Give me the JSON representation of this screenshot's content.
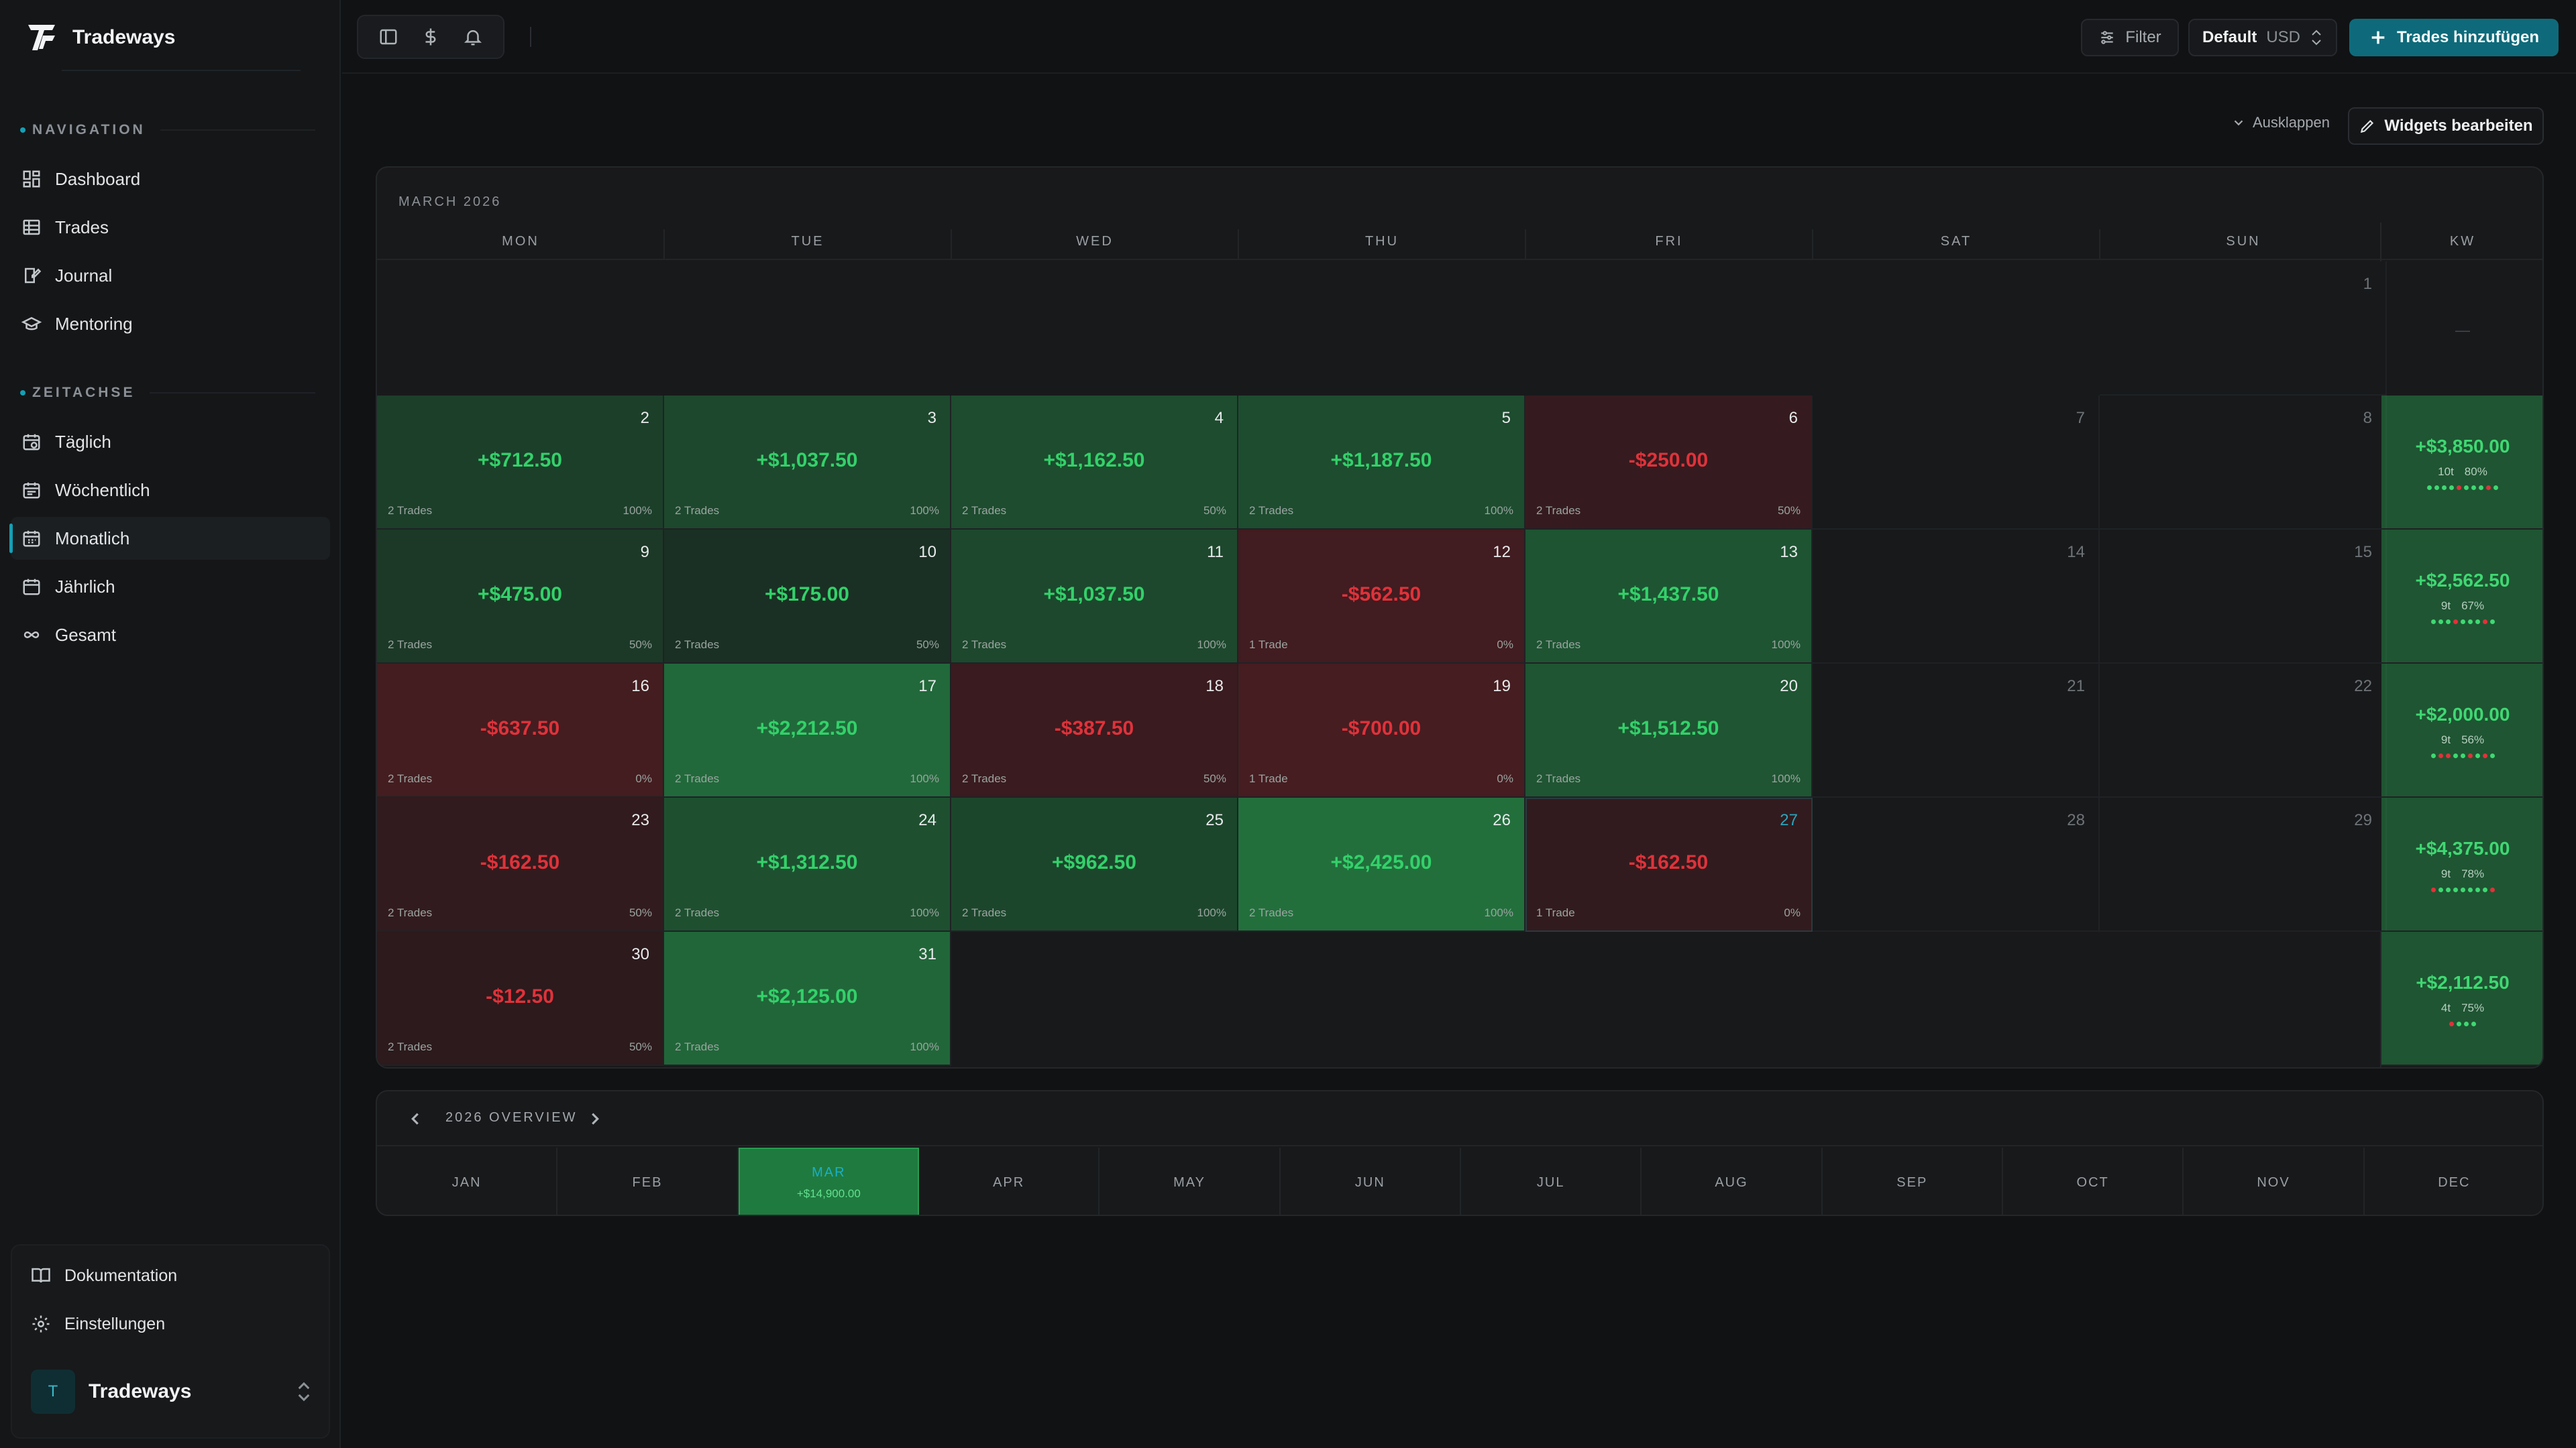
{
  "brand": {
    "name": "Tradeways"
  },
  "sidebar": {
    "section_nav": "NAVIGATION",
    "nav": [
      {
        "label": "Dashboard",
        "icon": "dashboard-icon"
      },
      {
        "label": "Trades",
        "icon": "table-icon"
      },
      {
        "label": "Journal",
        "icon": "journal-icon"
      },
      {
        "label": "Mentoring",
        "icon": "graduation-cap-icon"
      }
    ],
    "section_time": "ZEITACHSE",
    "timeline": [
      {
        "label": "Täglich",
        "icon": "calendar-clock-icon"
      },
      {
        "label": "Wöchentlich",
        "icon": "calendar-week-icon"
      },
      {
        "label": "Monatlich",
        "icon": "calendar-month-icon",
        "active": true
      },
      {
        "label": "Jährlich",
        "icon": "calendar-icon"
      },
      {
        "label": "Gesamt",
        "icon": "infinity-icon"
      }
    ],
    "bottom": [
      {
        "label": "Dokumentation",
        "icon": "book-icon"
      },
      {
        "label": "Einstellungen",
        "icon": "gear-icon"
      }
    ],
    "user": {
      "initial": "T",
      "name": "Tradeways"
    }
  },
  "topbar": {
    "filter_label": "Filter",
    "account_label": "Default",
    "currency_label": "USD",
    "add_label": "Trades hinzufügen"
  },
  "toolbar": {
    "collapse_label": "Ausklappen",
    "widgets_label": "Widgets bearbeiten"
  },
  "colors": {
    "accent": "#0e6a7a",
    "positive": "#33d16a",
    "negative": "#e0323a"
  },
  "calendar": {
    "title": "MARCH 2026",
    "weekdays": [
      "MON",
      "TUE",
      "WED",
      "THU",
      "FRI",
      "SAT",
      "SUN",
      "KW"
    ],
    "empty_kw": "—",
    "days": [
      {
        "n": "1",
        "row": 0,
        "col": 6
      },
      {
        "n": "2",
        "row": 1,
        "col": 0,
        "pnl": "+$712.50",
        "trades": "2 Trades",
        "rate": "100%",
        "value": 712.5
      },
      {
        "n": "3",
        "row": 1,
        "col": 1,
        "pnl": "+$1,037.50",
        "trades": "2 Trades",
        "rate": "100%",
        "value": 1037.5
      },
      {
        "n": "4",
        "row": 1,
        "col": 2,
        "pnl": "+$1,162.50",
        "trades": "2 Trades",
        "rate": "50%",
        "value": 1162.5
      },
      {
        "n": "5",
        "row": 1,
        "col": 3,
        "pnl": "+$1,187.50",
        "trades": "2 Trades",
        "rate": "100%",
        "value": 1187.5
      },
      {
        "n": "6",
        "row": 1,
        "col": 4,
        "pnl": "-$250.00",
        "trades": "2 Trades",
        "rate": "50%",
        "value": -250
      },
      {
        "n": "7",
        "row": 1,
        "col": 5
      },
      {
        "n": "8",
        "row": 1,
        "col": 6
      },
      {
        "n": "9",
        "row": 2,
        "col": 0,
        "pnl": "+$475.00",
        "trades": "2 Trades",
        "rate": "50%",
        "value": 475
      },
      {
        "n": "10",
        "row": 2,
        "col": 1,
        "pnl": "+$175.00",
        "trades": "2 Trades",
        "rate": "50%",
        "value": 175
      },
      {
        "n": "11",
        "row": 2,
        "col": 2,
        "pnl": "+$1,037.50",
        "trades": "2 Trades",
        "rate": "100%",
        "value": 1037.5
      },
      {
        "n": "12",
        "row": 2,
        "col": 3,
        "pnl": "-$562.50",
        "trades": "1 Trade",
        "rate": "0%",
        "value": -562.5
      },
      {
        "n": "13",
        "row": 2,
        "col": 4,
        "pnl": "+$1,437.50",
        "trades": "2 Trades",
        "rate": "100%",
        "value": 1437.5
      },
      {
        "n": "14",
        "row": 2,
        "col": 5
      },
      {
        "n": "15",
        "row": 2,
        "col": 6
      },
      {
        "n": "16",
        "row": 3,
        "col": 0,
        "pnl": "-$637.50",
        "trades": "2 Trades",
        "rate": "0%",
        "value": -637.5
      },
      {
        "n": "17",
        "row": 3,
        "col": 1,
        "pnl": "+$2,212.50",
        "trades": "2 Trades",
        "rate": "100%",
        "value": 2212.5
      },
      {
        "n": "18",
        "row": 3,
        "col": 2,
        "pnl": "-$387.50",
        "trades": "2 Trades",
        "rate": "50%",
        "value": -387.5
      },
      {
        "n": "19",
        "row": 3,
        "col": 3,
        "pnl": "-$700.00",
        "trades": "1 Trade",
        "rate": "0%",
        "value": -700
      },
      {
        "n": "20",
        "row": 3,
        "col": 4,
        "pnl": "+$1,512.50",
        "trades": "2 Trades",
        "rate": "100%",
        "value": 1512.5
      },
      {
        "n": "21",
        "row": 3,
        "col": 5
      },
      {
        "n": "22",
        "row": 3,
        "col": 6
      },
      {
        "n": "23",
        "row": 4,
        "col": 0,
        "pnl": "-$162.50",
        "trades": "2 Trades",
        "rate": "50%",
        "value": -162.5
      },
      {
        "n": "24",
        "row": 4,
        "col": 1,
        "pnl": "+$1,312.50",
        "trades": "2 Trades",
        "rate": "100%",
        "value": 1312.5
      },
      {
        "n": "25",
        "row": 4,
        "col": 2,
        "pnl": "+$962.50",
        "trades": "2 Trades",
        "rate": "100%",
        "value": 962.5
      },
      {
        "n": "26",
        "row": 4,
        "col": 3,
        "pnl": "+$2,425.00",
        "trades": "2 Trades",
        "rate": "100%",
        "value": 2425
      },
      {
        "n": "27",
        "row": 4,
        "col": 4,
        "pnl": "-$162.50",
        "trades": "1 Trade",
        "rate": "0%",
        "value": -162.5,
        "today": true
      },
      {
        "n": "28",
        "row": 4,
        "col": 5
      },
      {
        "n": "29",
        "row": 4,
        "col": 6
      },
      {
        "n": "30",
        "row": 5,
        "col": 0,
        "pnl": "-$12.50",
        "trades": "2 Trades",
        "rate": "50%",
        "value": -12.5
      },
      {
        "n": "31",
        "row": 5,
        "col": 1,
        "pnl": "+$2,125.00",
        "trades": "2 Trades",
        "rate": "100%",
        "value": 2125
      }
    ],
    "weeks": [
      {
        "row": 1,
        "pnl": "+$3,850.00",
        "trades": "10t",
        "rate": "80%",
        "dots": [
          "g",
          "g",
          "g",
          "g",
          "r",
          "g",
          "g",
          "g",
          "r",
          "g"
        ]
      },
      {
        "row": 2,
        "pnl": "+$2,562.50",
        "trades": "9t",
        "rate": "67%",
        "dots": [
          "g",
          "g",
          "g",
          "r",
          "g",
          "g",
          "g",
          "r",
          "g"
        ]
      },
      {
        "row": 3,
        "pnl": "+$2,000.00",
        "trades": "9t",
        "rate": "56%",
        "dots": [
          "g",
          "r",
          "r",
          "g",
          "g",
          "r",
          "g",
          "r",
          "g"
        ]
      },
      {
        "row": 4,
        "pnl": "+$4,375.00",
        "trades": "9t",
        "rate": "78%",
        "dots": [
          "r",
          "g",
          "g",
          "g",
          "g",
          "g",
          "g",
          "g",
          "r"
        ]
      },
      {
        "row": 5,
        "pnl": "+$2,112.50",
        "trades": "4t",
        "rate": "75%",
        "dots": [
          "r",
          "g",
          "g",
          "g"
        ]
      }
    ]
  },
  "overview": {
    "title": "2026 OVERVIEW",
    "months": [
      {
        "label": "JAN"
      },
      {
        "label": "FEB"
      },
      {
        "label": "MAR",
        "value": "+$14,900.00",
        "active": true
      },
      {
        "label": "APR"
      },
      {
        "label": "MAY"
      },
      {
        "label": "JUN"
      },
      {
        "label": "JUL"
      },
      {
        "label": "AUG"
      },
      {
        "label": "SEP"
      },
      {
        "label": "OCT"
      },
      {
        "label": "NOV"
      },
      {
        "label": "DEC"
      }
    ]
  }
}
